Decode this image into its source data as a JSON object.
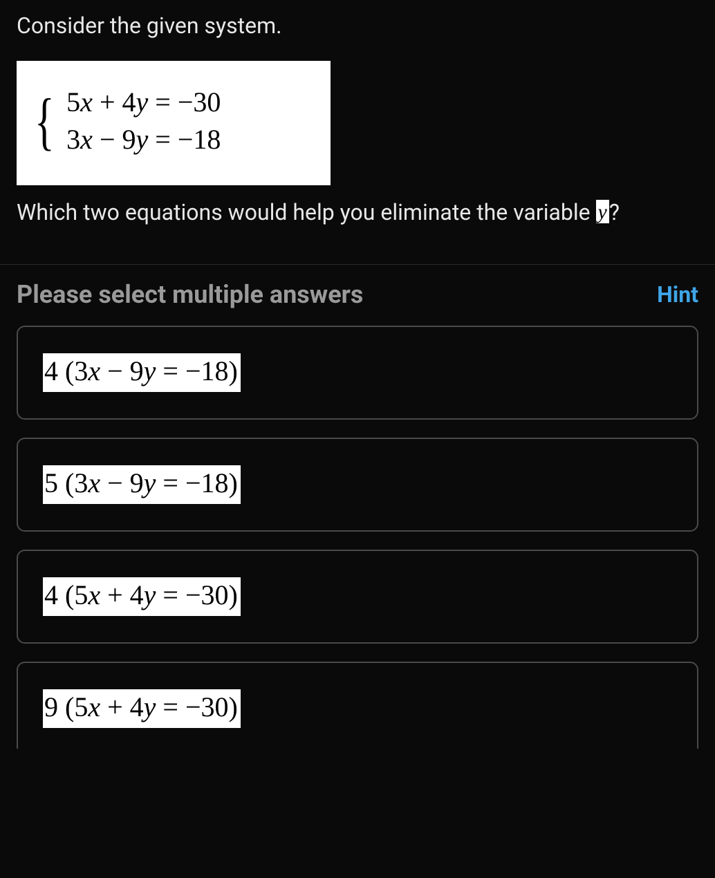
{
  "question": {
    "prompt_line_1": "Consider the given system.",
    "equations": {
      "line_1": "5x + 4y = −30",
      "line_2": "3x − 9y = −18"
    },
    "prompt_line_2_prefix": "Which two equations would help you eliminate the variable ",
    "prompt_line_2_variable": "y",
    "prompt_line_2_suffix": "?"
  },
  "answers": {
    "instruction": "Please select multiple answers",
    "hint_label": "Hint",
    "options": [
      "4 (3x − 9y = −18)",
      "5 (3x − 9y = −18)",
      "4 (5x + 4y = −30)",
      "9 (5x + 4y = −30)"
    ]
  }
}
